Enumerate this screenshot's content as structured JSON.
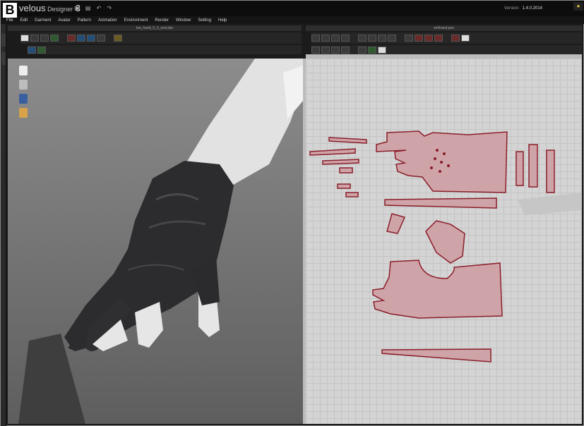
{
  "figure": {
    "label": "B"
  },
  "app": {
    "title_main": "velous",
    "title_sub": " Designer",
    "title_ver": " 3",
    "version_label": "Version:",
    "version_value": "1.4.0.2014"
  },
  "menu": [
    "File",
    "Edit",
    "Garment",
    "Avatar",
    "Pattern",
    "Animation",
    "Environment",
    "Render",
    "Window",
    "Setting",
    "Help"
  ],
  "panels": {
    "left_title": "lea_hand_0_3_end.sbs",
    "right_title": "sm/hand.pos"
  },
  "left_toolbar": {
    "row1": [
      {
        "icon": "move-icon",
        "color": "w"
      },
      {
        "icon": "select-icon",
        "color": "n"
      },
      {
        "icon": "select-mesh-icon",
        "color": "n"
      },
      {
        "icon": "pin-green-icon",
        "color": "g"
      },
      {
        "icon": "pin-red-icon",
        "color": "r"
      },
      {
        "icon": "tack-icon",
        "color": "b"
      },
      {
        "icon": "tack-blue-icon",
        "color": "b"
      },
      {
        "icon": "avatar-tool-icon",
        "color": "n"
      },
      {
        "icon": "avatar-pose-icon",
        "color": "y"
      }
    ],
    "row2": [
      {
        "icon": "view-icon",
        "color": "b"
      },
      {
        "icon": "view-mode-icon",
        "color": "g"
      }
    ]
  },
  "right_toolbar": {
    "row1": [
      {
        "icon": "transform-icon",
        "color": "n"
      },
      {
        "icon": "edit-point-icon",
        "color": "n"
      },
      {
        "icon": "edit-curve-icon",
        "color": "n"
      },
      {
        "icon": "polygon-icon",
        "color": "n"
      },
      {
        "icon": "rectangle-icon",
        "color": "n"
      },
      {
        "icon": "circle-icon",
        "color": "n"
      },
      {
        "icon": "internal-polygon-icon",
        "color": "n"
      },
      {
        "icon": "internal-rect-icon",
        "color": "n"
      },
      {
        "icon": "internal-circle-icon",
        "color": "n"
      },
      {
        "icon": "dart-icon",
        "color": "r"
      },
      {
        "icon": "segment-sew-icon",
        "color": "r"
      },
      {
        "icon": "free-sew-icon",
        "color": "r"
      },
      {
        "icon": "edit-sew-icon",
        "color": "r"
      },
      {
        "icon": "fold-icon",
        "color": "w"
      }
    ],
    "row2": [
      {
        "icon": "layout-icon",
        "color": "n"
      },
      {
        "icon": "grid-icon",
        "color": "n"
      },
      {
        "icon": "align-icon",
        "color": "n"
      },
      {
        "icon": "notch-icon",
        "color": "n"
      },
      {
        "icon": "trace-icon",
        "color": "n"
      },
      {
        "icon": "texture-icon",
        "color": "g"
      },
      {
        "icon": "zoom-icon",
        "color": "w"
      }
    ]
  },
  "avatar_icons": [
    "shirt-icon",
    "avatar-icon",
    "avatar-blue-icon",
    "head-icon"
  ],
  "colors": {
    "pattern_fill": "#cfa4a8",
    "pattern_stroke": "#8a1e2a",
    "glove": "#2c2c2e",
    "skin": "#e6e6e6"
  }
}
